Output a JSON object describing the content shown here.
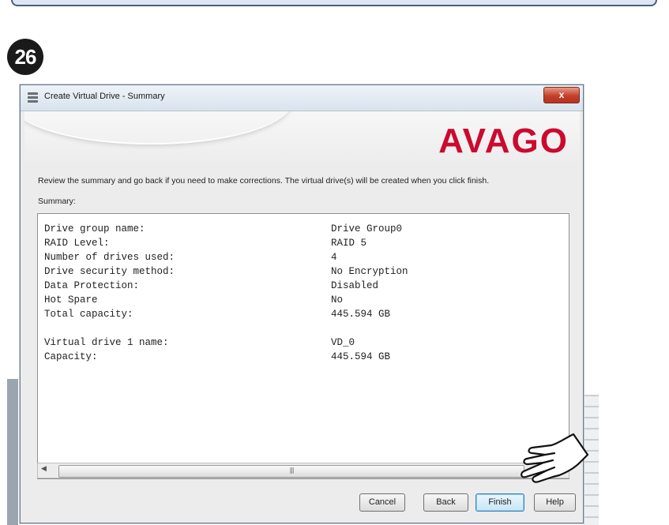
{
  "step_number": "26",
  "window": {
    "title": "Create Virtual Drive - Summary",
    "close_label": "x",
    "logo_text": "AVAGO",
    "instruction": "Review the summary and go back if you need to make corrections. The virtual drive(s) will be created when you click finish.",
    "summary_label": "Summary:"
  },
  "summary": {
    "rows": [
      {
        "key": "Drive group name:",
        "value": "Drive Group0"
      },
      {
        "key": "RAID Level:",
        "value": "RAID  5"
      },
      {
        "key": "Number of drives used:",
        "value": "4"
      },
      {
        "key": "Drive security method:",
        "value": "No Encryption"
      },
      {
        "key": "Data Protection:",
        "value": "Disabled"
      },
      {
        "key": "Hot Spare",
        "value": "No"
      },
      {
        "key": "Total capacity:",
        "value": "445.594 GB"
      }
    ],
    "vd_rows": [
      {
        "key": "Virtual drive 1 name:",
        "value": "VD_0"
      },
      {
        "key": "Capacity:",
        "value": "445.594 GB"
      }
    ]
  },
  "scrollbar": {
    "left_arrow": "◀",
    "grip": "|||"
  },
  "buttons": {
    "cancel": "Cancel",
    "back": "Back",
    "finish": "Finish",
    "help": "Help"
  },
  "colors": {
    "logo": "#cc092f",
    "badge": "#1a1a1a",
    "close_button": "#c4402a"
  }
}
